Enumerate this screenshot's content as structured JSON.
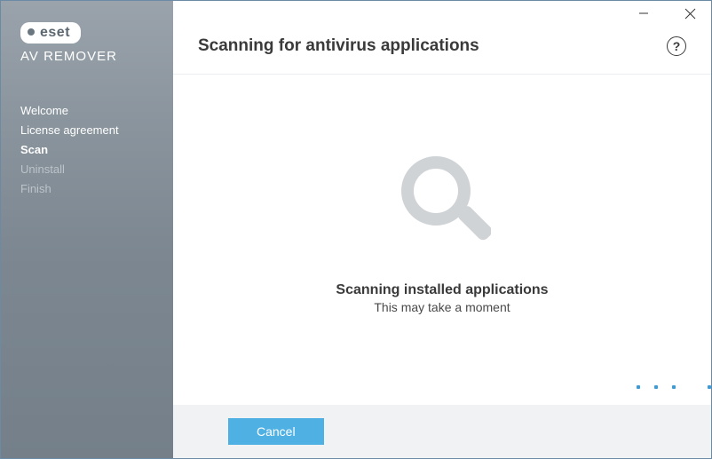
{
  "brand": {
    "logo_text": "eset",
    "sub_text": "AV REMOVER"
  },
  "sidebar": {
    "items": [
      {
        "label": "Welcome",
        "state": "done"
      },
      {
        "label": "License agreement",
        "state": "done"
      },
      {
        "label": "Scan",
        "state": "active"
      },
      {
        "label": "Uninstall",
        "state": "pending"
      },
      {
        "label": "Finish",
        "state": "pending"
      }
    ]
  },
  "header": {
    "title": "Scanning for antivirus applications"
  },
  "body": {
    "status_title": "Scanning installed applications",
    "status_sub": "This may take a moment"
  },
  "footer": {
    "cancel_label": "Cancel"
  }
}
